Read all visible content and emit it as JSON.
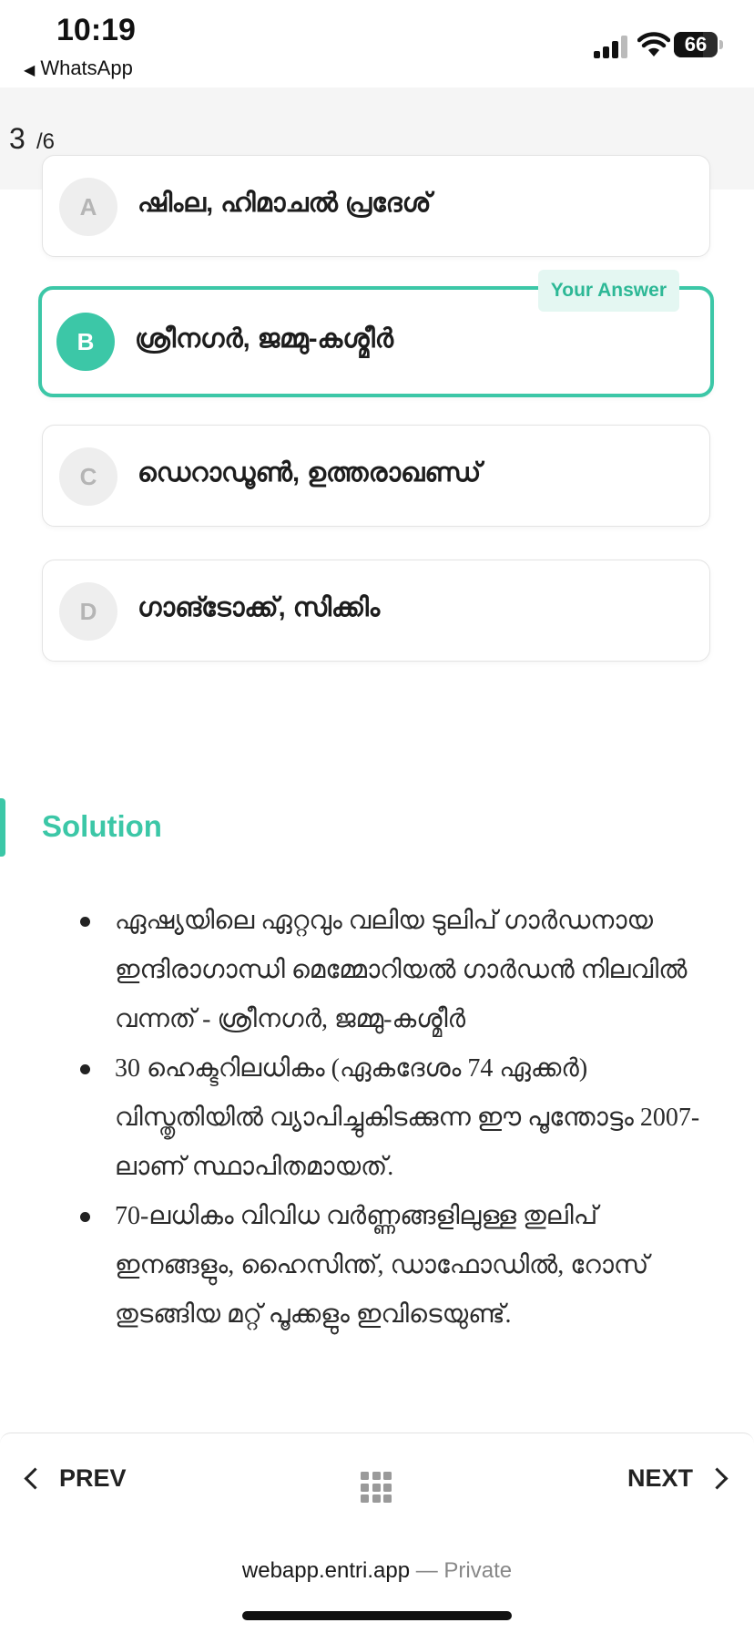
{
  "status_bar": {
    "time": "10:19",
    "back_app": "WhatsApp",
    "battery": "66",
    "battery_fraction": 0.66
  },
  "progress": {
    "current": "3",
    "total": "/6"
  },
  "options": [
    {
      "letter": "A",
      "text": "ഷിംല, ഹിമാചൽ പ്രദേശ്",
      "selected": false
    },
    {
      "letter": "B",
      "text": "ശ്രീനഗർ, ജമ്മു-കശ്മീർ",
      "selected": true
    },
    {
      "letter": "C",
      "text": "ഡെറാഡൂൺ, ഉത്തരാഖണ്ഡ്",
      "selected": false
    },
    {
      "letter": "D",
      "text": "ഗാങ്ടോക്ക്, സിക്കിം",
      "selected": false
    }
  ],
  "your_answer_label": "Your Answer",
  "solution": {
    "title": "Solution",
    "points": [
      "ഏഷ്യയിലെ ഏറ്റവും വലിയ ടുലിപ് ഗാർഡനായ ഇന്ദിരാഗാന്ധി മെമ്മോറിയൽ ഗാർഡൻ നിലവിൽ വന്നത് - ശ്രീനഗർ, ജമ്മു-കശ്മീർ",
      "30 ഹെക്ടറിലധികം (ഏകദേശം 74 ഏക്കർ) വിസ്തൃതിയിൽ വ്യാപിച്ചുകിടക്കുന്ന ഈ പൂന്തോട്ടം 2007-ലാണ് സ്ഥാപിതമായത്.",
      "70-ലധികം വിവിധ വർണ്ണങ്ങളിലുള്ള തുലിപ് ഇനങ്ങളും, ഹൈസിന്ത്, ഡാഫോഡിൽ, റോസ് തുടങ്ങിയ മറ്റ് പൂക്കളും ഇവിടെയുണ്ട്."
    ]
  },
  "nav": {
    "prev": "PREV",
    "next": "NEXT"
  },
  "browser": {
    "domain": "webapp.entri.app",
    "separator": "—",
    "mode": "Private"
  },
  "colors": {
    "accent": "#3cc7a7",
    "accent_light": "#e4f7f2"
  }
}
